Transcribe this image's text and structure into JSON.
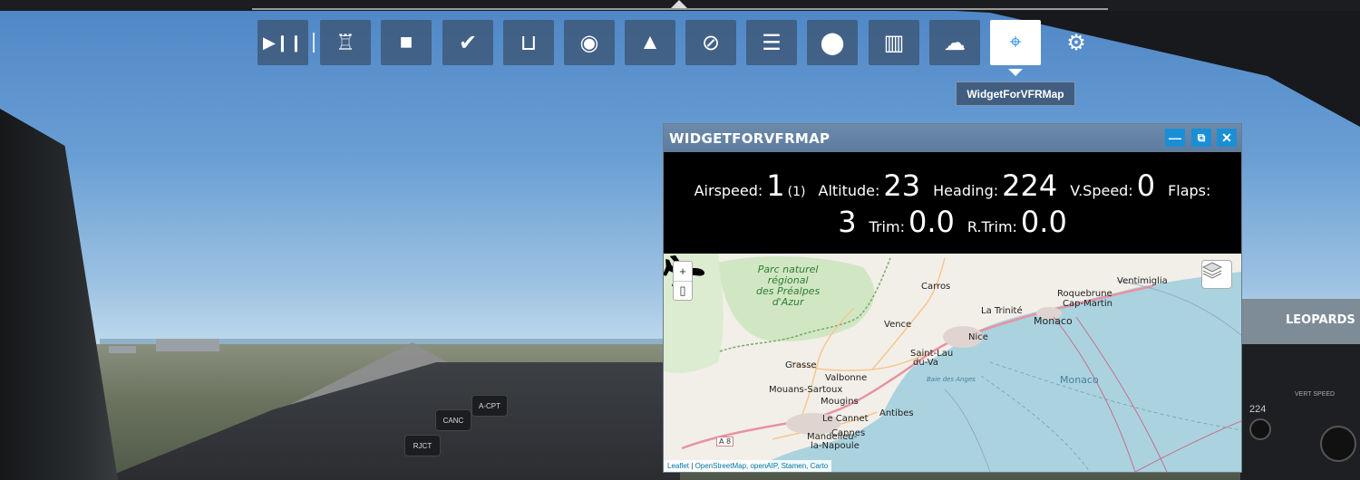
{
  "toolbar": {
    "buttons": [
      {
        "icon": "play-pause-icon",
        "glyph": "▶❙❙",
        "active": false
      },
      {
        "icon": "control-tower-icon",
        "glyph": "♖",
        "active": false
      },
      {
        "icon": "camera-icon",
        "glyph": "■",
        "active": false
      },
      {
        "icon": "checklist-check-icon",
        "glyph": "✔",
        "active": false
      },
      {
        "icon": "yoke-icon",
        "glyph": "⊔",
        "active": false
      },
      {
        "icon": "pilot-cap-icon",
        "glyph": "◉",
        "active": false
      },
      {
        "icon": "weight-icon",
        "glyph": "▲",
        "active": false
      },
      {
        "icon": "compass-icon",
        "glyph": "⊘",
        "active": false
      },
      {
        "icon": "list-icon",
        "glyph": "☰",
        "active": false
      },
      {
        "icon": "map-pin-icon",
        "glyph": "⬤",
        "active": false
      },
      {
        "icon": "map-icon",
        "glyph": "▥",
        "active": false
      },
      {
        "icon": "weather-cloud-icon",
        "glyph": "☁",
        "active": false
      },
      {
        "icon": "vfr-map-widget-icon",
        "glyph": "⌖",
        "active": true
      },
      {
        "icon": "settings-gear-icon",
        "glyph": "⚙",
        "active": false
      }
    ],
    "tooltip": "WidgetForVFRMap"
  },
  "panel": {
    "title": "WIDGETFORVFRMAP",
    "controls": {
      "minimize": "—",
      "popout": "⧉",
      "close": "✕"
    }
  },
  "readout": {
    "airspeed_label": "Airspeed:",
    "airspeed": "1",
    "airspeed_sub": "(1)",
    "altitude_label": "Altitude:",
    "altitude": "23",
    "heading_label": "Heading:",
    "heading": "224",
    "vspeed_label": "V.Speed:",
    "vspeed": "0",
    "flaps_label": "Flaps:",
    "flaps": "3",
    "trim_label": "Trim:",
    "trim": "0.0",
    "rtrim_label": "R.Trim:",
    "rtrim": "0.0"
  },
  "map": {
    "zoom_in": "+",
    "zoom_out": "▯",
    "park_label": [
      "Parc naturel",
      "régional",
      "des Préalpes",
      "d'Azur"
    ],
    "places": {
      "carros": "Carros",
      "vence": "Vence",
      "nice": "Nice",
      "la_trinite": "La Trinité",
      "roquebrune": "Roquebrune",
      "cap_martin": "Cap-Martin",
      "ventimiglia": "Ventimiglia",
      "monaco_city": "Monaco",
      "saint_laurent": "Saint-Lau",
      "du_var": "du-Va",
      "grasse": "Grasse",
      "valbonne": "Valbonne",
      "mouans_sartoux": "Mouans-Sartoux",
      "mougins": "Mougins",
      "le_cannet": "Le Cannet",
      "antibes": "Antibes",
      "mandelieu": "Mandelieu-",
      "la_napoule": "la-Napoule",
      "cannes": "Cannes",
      "baie_des_anges": "Baie des Anges",
      "monaco_sea": "Monaco",
      "a8": "A 8"
    },
    "attribution": {
      "leaflet": "Leaflet",
      "sep": " | ",
      "sources": "OpenStreetMap, openAIP, Stamen, Carto"
    }
  },
  "scenery": {
    "leopard_sign": "LEOPARDS",
    "tag_acpt": "A-CPT",
    "tag_canc": "CANC",
    "tag_rjct": "RJCT",
    "vert_speed": "VERT SPEED",
    "heading_display": "224"
  },
  "colors": {
    "accent": "#1a8fd6",
    "toolbar_bg": "#3c5573",
    "panel_title": "#5d7c9e",
    "map_sea": "#aad3df",
    "map_land": "#f2efe9"
  }
}
